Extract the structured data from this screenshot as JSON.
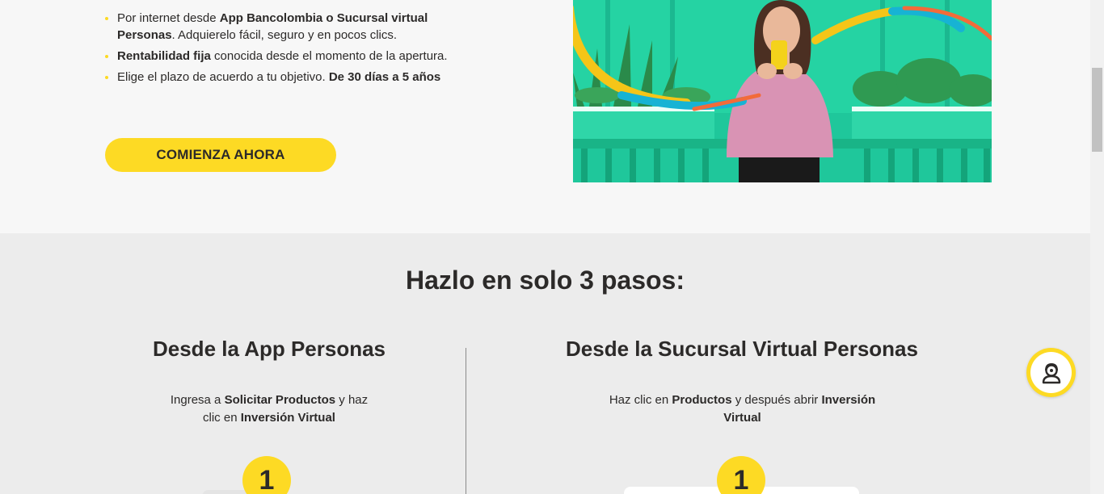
{
  "hero": {
    "bullets": [
      {
        "pre": "Por internet desde ",
        "bold": "App Bancolombia o Sucursal virtual Personas",
        "post": ". Adquierelo fácil, seguro y en pocos clics."
      },
      {
        "pre": "",
        "bold": "Rentabilidad fija",
        "post": " conocida desde el momento de la apertura."
      },
      {
        "pre": "Elige el plazo de acuerdo a tu objetivo. ",
        "bold": "De 30 días a 5 años",
        "post": ""
      }
    ],
    "cta_label": "COMIENZA AHORA"
  },
  "steps": {
    "title": "Hazlo en solo 3 pasos:",
    "left": {
      "title": "Desde la App Personas",
      "desc_pre": "Ingresa a ",
      "desc_bold1": "Solicitar Productos",
      "desc_mid": " y haz clic en ",
      "desc_bold2": "Inversión Virtual",
      "step_number": "1"
    },
    "right": {
      "title": "Desde la Sucursal Virtual Personas",
      "desc_pre": "Haz clic en ",
      "desc_bold1": "Productos",
      "desc_mid": " y después abrir ",
      "desc_bold2": "Inversión Virtual",
      "step_number": "1"
    }
  },
  "colors": {
    "brand_yellow": "#fdda24",
    "text_dark": "#2c2a29",
    "hero_bg": "#f7f7f7",
    "steps_bg": "#ececec"
  },
  "icons": {
    "chat": "chat-agent-icon"
  }
}
